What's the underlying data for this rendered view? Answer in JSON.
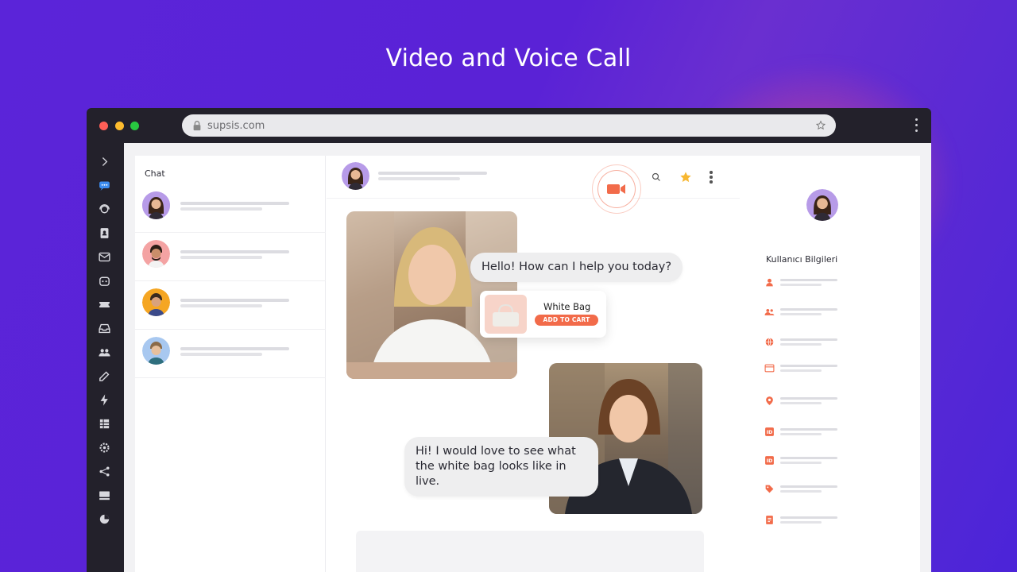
{
  "headline": "Video and Voice Call",
  "browser": {
    "url": "supsis.com"
  },
  "sidebar": {
    "icons": [
      "chevron-right-icon",
      "chat-icon",
      "support-agent-icon",
      "contacts-icon",
      "mail-icon",
      "bot-icon",
      "ticket-icon",
      "inbox-icon",
      "users-icon",
      "edit-icon",
      "bolt-icon",
      "grid-icon",
      "settings-icon",
      "share-icon",
      "display-icon",
      "pie-chart-icon"
    ]
  },
  "chat_list": {
    "title": "Chat",
    "conversations": [
      {
        "avatar": "avatar-woman-purple"
      },
      {
        "avatar": "avatar-man-pink"
      },
      {
        "avatar": "avatar-man-orange"
      },
      {
        "avatar": "avatar-man-blue"
      }
    ]
  },
  "messages": {
    "agent_text": "Hello! How can I help you today?",
    "customer_text": "Hi! I would love to see what the white bag looks like in live."
  },
  "product": {
    "name": "White Bag",
    "cta": "ADD TO CART"
  },
  "info_panel": {
    "title": "Kullanıcı Bilgileri",
    "rows": [
      "user-icon",
      "users-icon",
      "globe-icon",
      "browser-icon",
      "location-icon",
      "id-icon",
      "id-icon",
      "tag-icon",
      "note-icon"
    ]
  },
  "colors": {
    "accent": "#f26b4a",
    "star": "#f7b731",
    "background": "#5a22d6"
  }
}
